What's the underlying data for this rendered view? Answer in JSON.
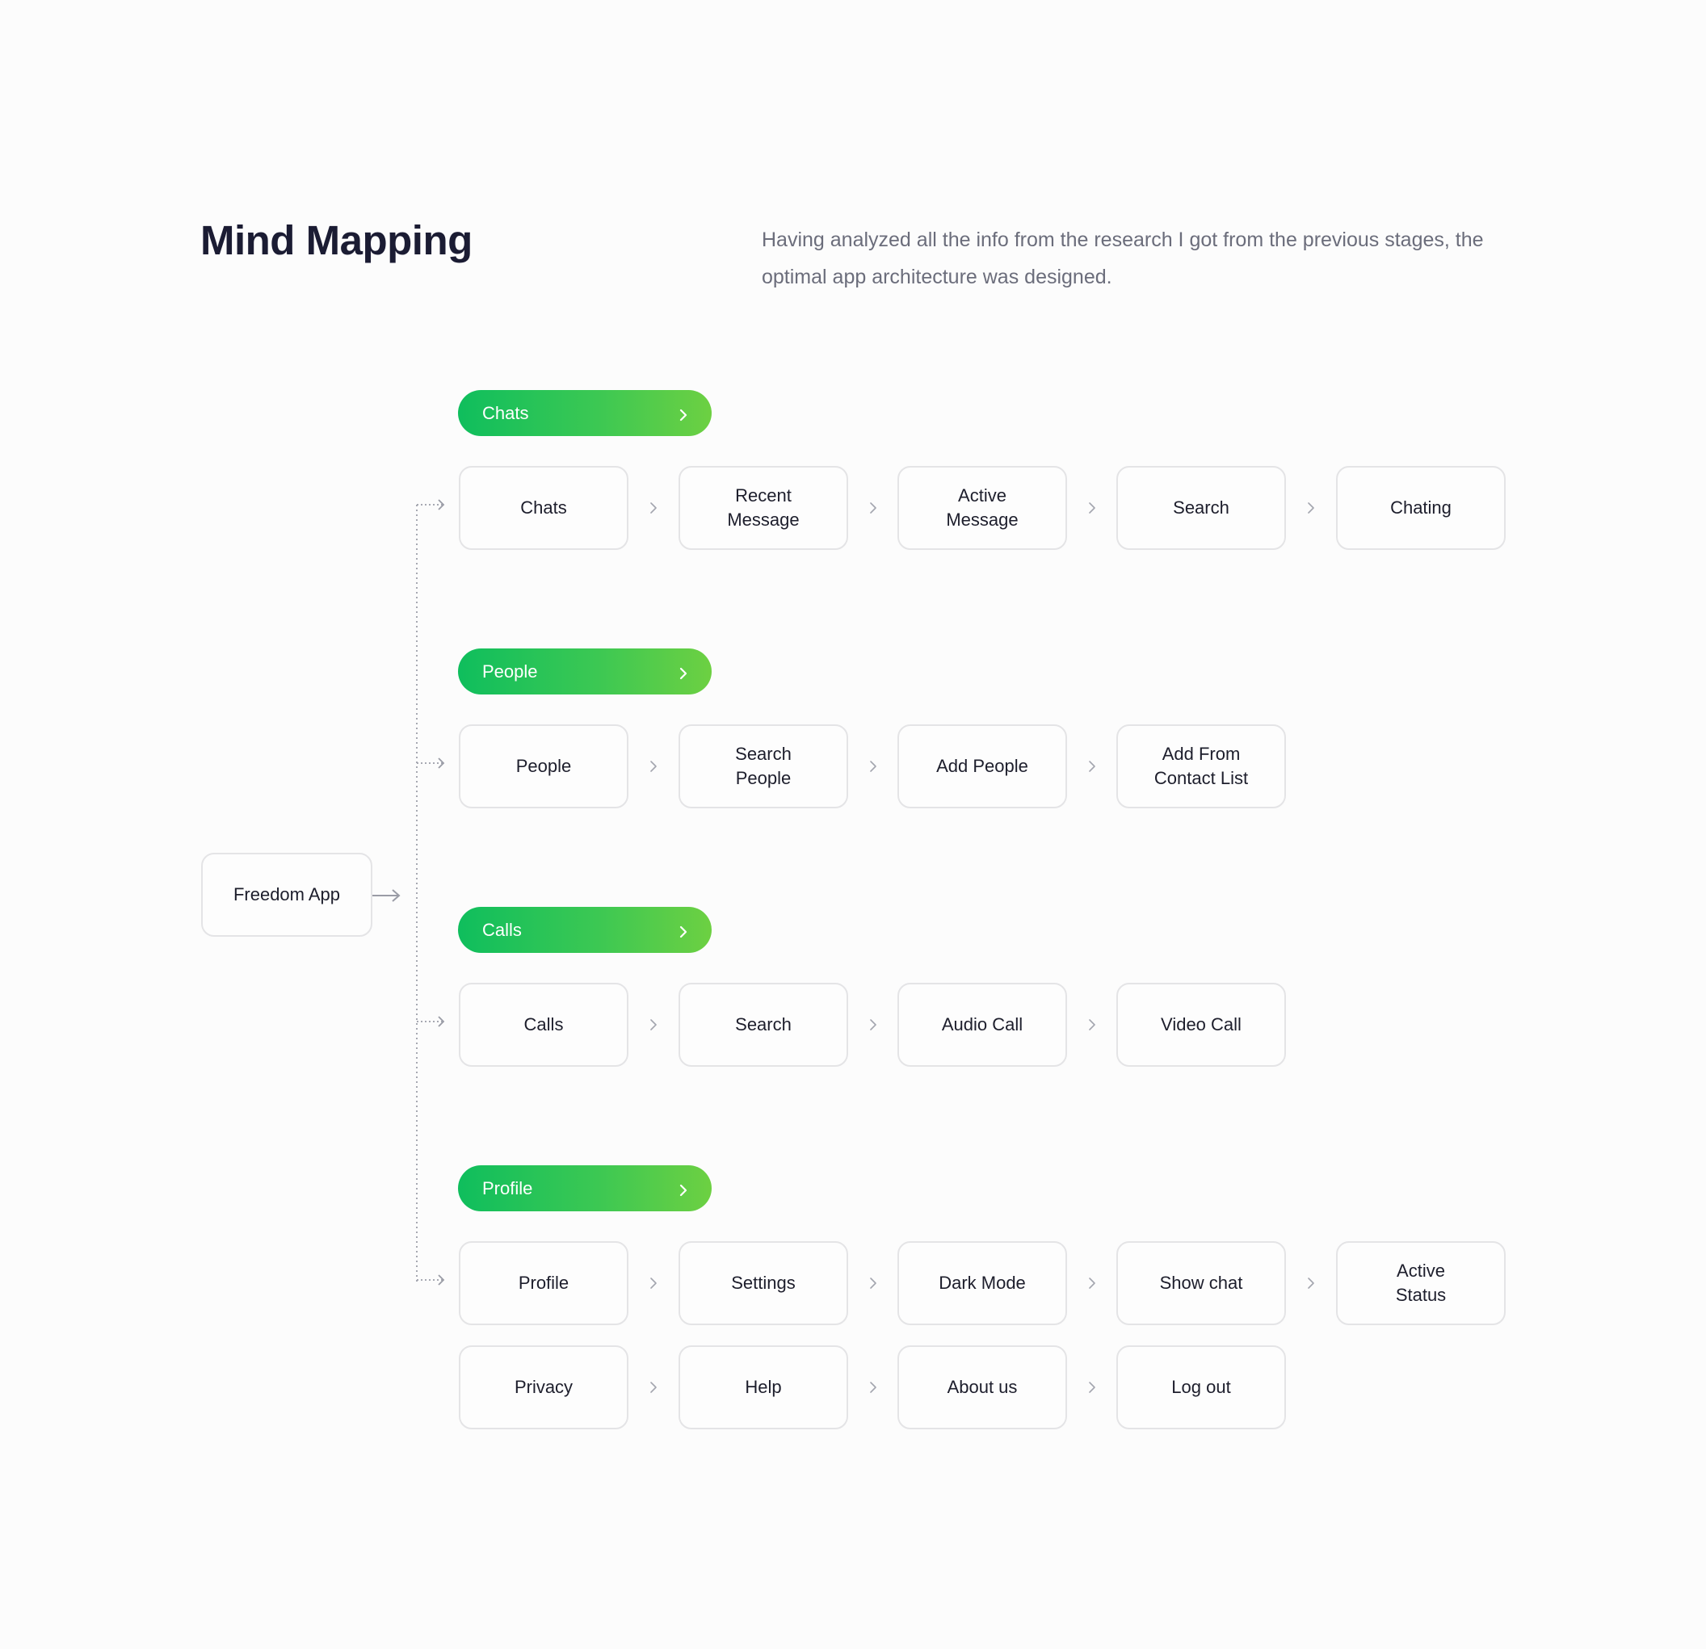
{
  "header": {
    "title": "Mind Mapping",
    "description": "Having analyzed all the info from the research I got from the previous stages, the optimal app architecture was designed."
  },
  "colors": {
    "pill_gradient_start": "#0fbe5d",
    "pill_gradient_end": "#6dd042",
    "node_border": "#e4e4e6",
    "connector": "#9a9ca6",
    "title": "#1b1c33",
    "description": "#6b6d7b"
  },
  "root": {
    "label": "Freedom App"
  },
  "branches": [
    {
      "label": "Chats",
      "rows": [
        [
          "Chats",
          "Recent\nMessage",
          "Active\nMessage",
          "Search",
          "Chating"
        ]
      ]
    },
    {
      "label": "People",
      "rows": [
        [
          "People",
          "Search\nPeople",
          "Add People",
          "Add From\nContact List"
        ]
      ]
    },
    {
      "label": "Calls",
      "rows": [
        [
          "Calls",
          "Search",
          "Audio Call",
          "Video Call"
        ]
      ]
    },
    {
      "label": "Profile",
      "rows": [
        [
          "Profile",
          "Settings",
          "Dark Mode",
          "Show chat",
          "Active\nStatus"
        ],
        [
          "Privacy",
          "Help",
          "About us",
          "Log out"
        ]
      ]
    }
  ]
}
